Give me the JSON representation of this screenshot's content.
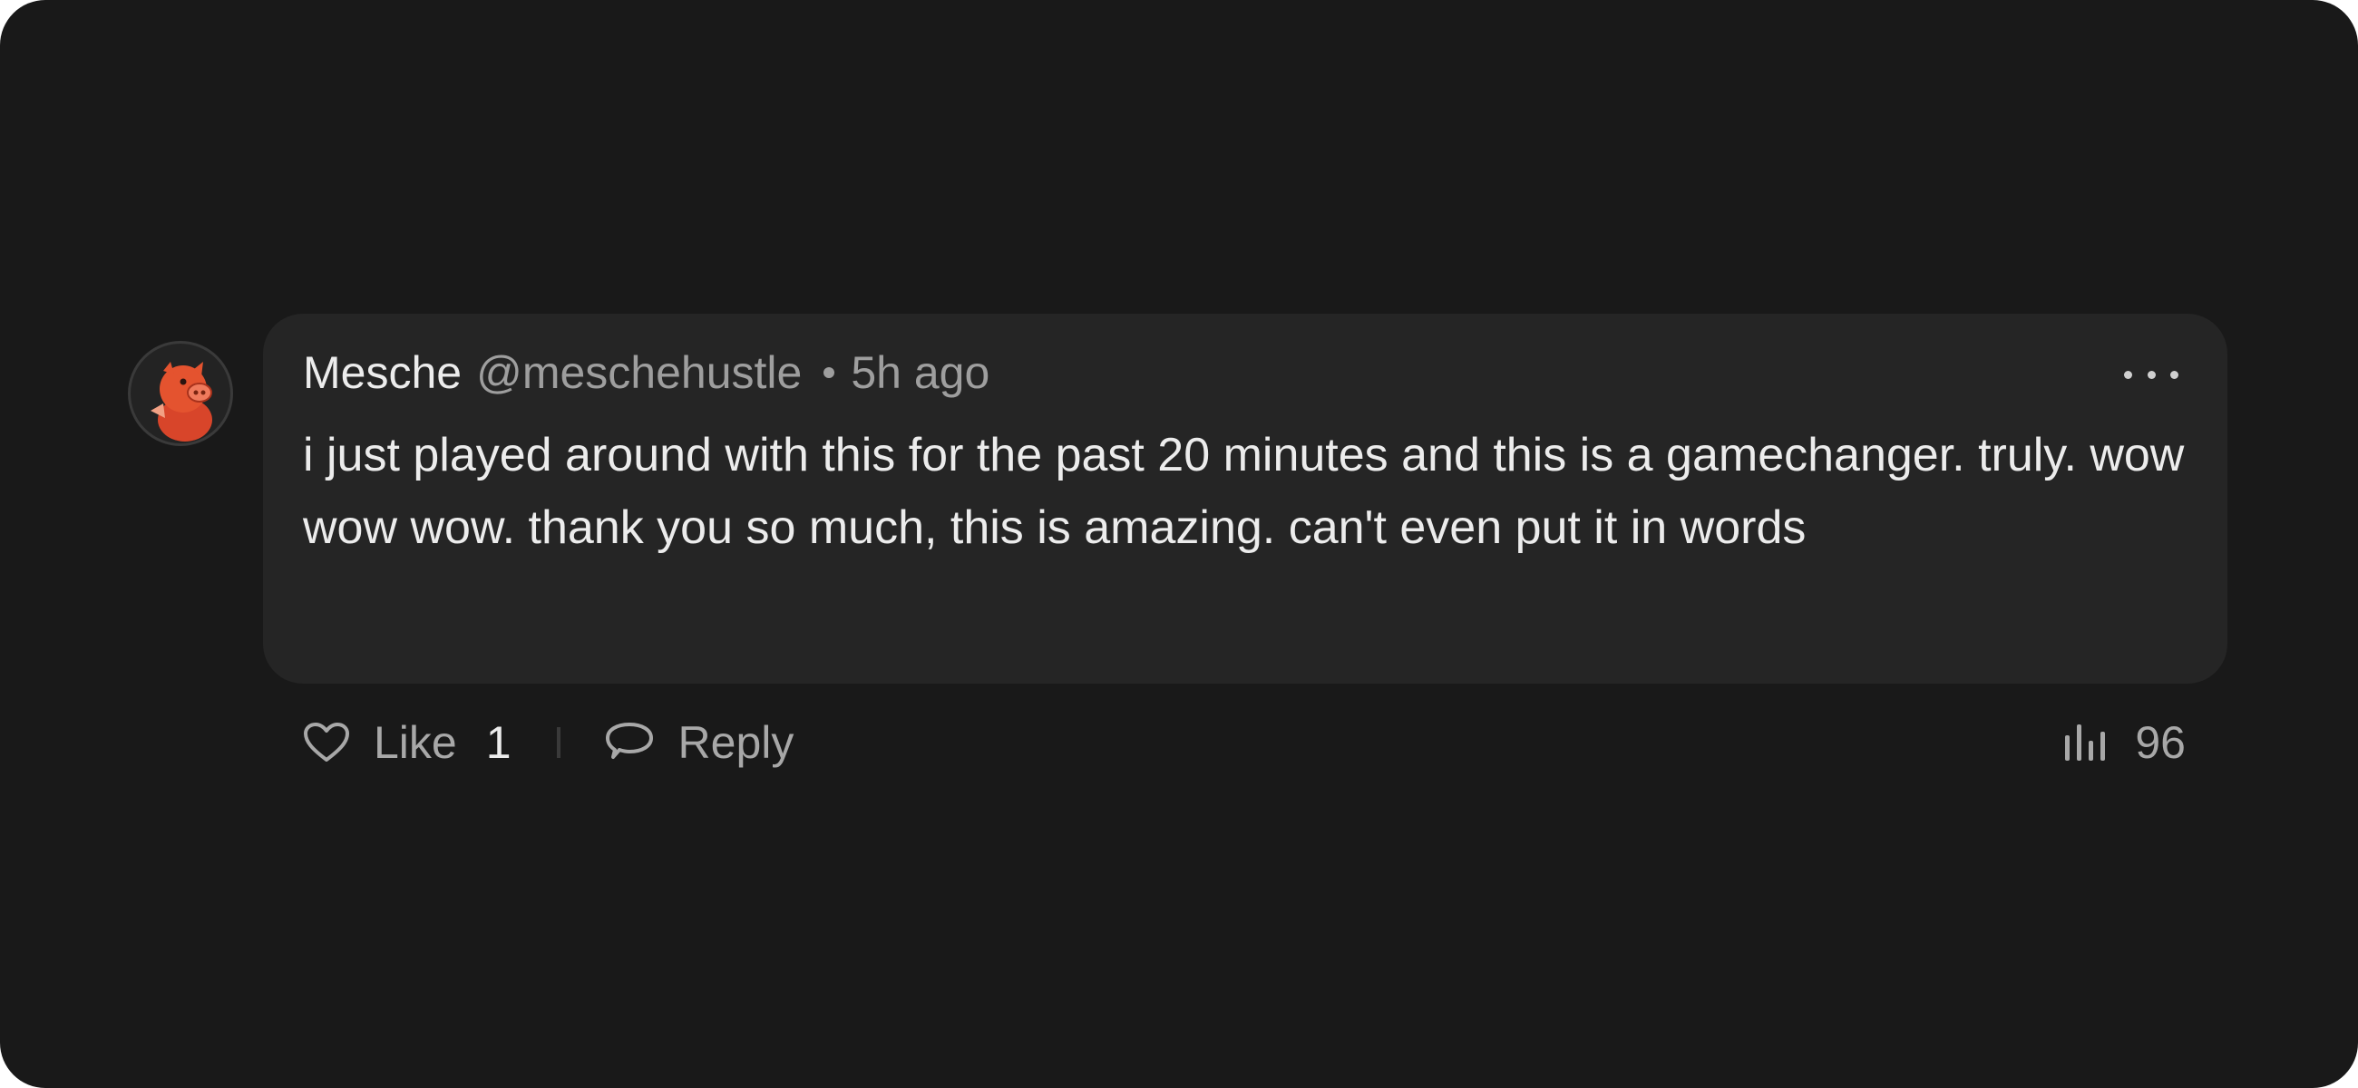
{
  "comment": {
    "author_name": "Mesche",
    "author_handle": "@meschehustle",
    "timestamp": "5h ago",
    "body": "i just played around with this for the past 20 minutes and this is a gamechanger. truly. wow wow wow. thank you so much, this is amazing. can't even put it in words",
    "avatar_icon": "pig-avatar-icon",
    "more_icon": "more-options-icon"
  },
  "actions": {
    "like_label": "Like",
    "like_count": "1",
    "like_icon": "heart-icon",
    "reply_label": "Reply",
    "reply_icon": "speech-bubble-icon",
    "views_count": "96",
    "views_icon": "bar-chart-icon"
  },
  "colors": {
    "background": "#191919",
    "bubble": "#252525",
    "primary_text": "#ececec",
    "secondary_text": "#9e9e9e",
    "avatar_accent": "#e4532f"
  }
}
